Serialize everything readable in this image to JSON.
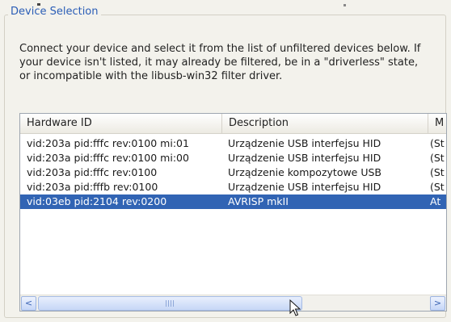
{
  "group": {
    "title": "Device Selection"
  },
  "intro_text": "Connect your device and select it from the list of unfiltered devices below. If your device isn't listed, it may already be filtered, be in a \"driverless\" state, or incompatible with the libusb-win32 filter driver.",
  "list": {
    "columns": [
      "Hardware ID",
      "Description",
      "M"
    ],
    "rows": [
      {
        "hw": "vid:203a pid:fffc rev:0100 mi:01",
        "desc": "Urządzenie USB interfejsu HID",
        "m": "(St"
      },
      {
        "hw": "vid:203a pid:fffc rev:0100 mi:00",
        "desc": "Urządzenie USB interfejsu HID",
        "m": "(St"
      },
      {
        "hw": "vid:203a pid:fffc rev:0100",
        "desc": "Urządzenie kompozytowe USB",
        "m": "(St"
      },
      {
        "hw": "vid:203a pid:fffb rev:0100",
        "desc": "Urządzenie USB interfejsu HID",
        "m": "(St"
      },
      {
        "hw": "vid:03eb pid:2104 rev:0200",
        "desc": "AVRISP mkII",
        "m": "At"
      }
    ],
    "selected_index": 4
  },
  "scrollbar": {
    "left_arrow": "<",
    "right_arrow": ">"
  },
  "colors": {
    "selection": "#3164b4",
    "group_title": "#2a5db6"
  }
}
